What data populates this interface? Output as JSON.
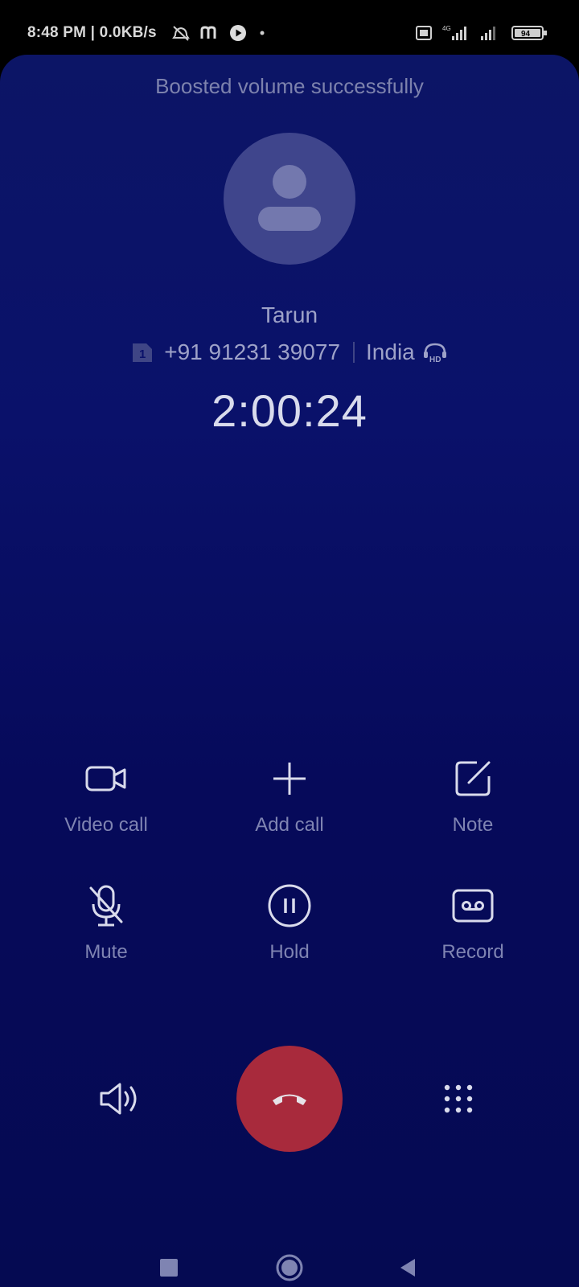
{
  "status_bar": {
    "time_text": "8:48 PM | 0.0KB/s",
    "battery": "94",
    "network": "4G"
  },
  "toast": "Boosted volume successfully",
  "contact": {
    "name": "Tarun",
    "sim_slot": "1",
    "number": "+91 91231 39077",
    "location": "India",
    "hd_badge": "HD"
  },
  "call_timer": "2:00:24",
  "controls": {
    "video_call": {
      "label": "Video call",
      "icon": "video-camera-icon"
    },
    "add_call": {
      "label": "Add call",
      "icon": "plus-icon"
    },
    "note": {
      "label": "Note",
      "icon": "edit-note-icon"
    },
    "mute": {
      "label": "Mute",
      "icon": "mic-off-icon"
    },
    "hold": {
      "label": "Hold",
      "icon": "pause-circle-icon"
    },
    "record": {
      "label": "Record",
      "icon": "cassette-icon"
    }
  },
  "bottom_actions": {
    "speaker": "speaker-icon",
    "end_call": "end-call-icon",
    "dialpad": "dialpad-icon"
  },
  "colors": {
    "background": "#0a116a",
    "end_call": "#a82a3c",
    "label": "#7f84b2",
    "icon": "#d9dbec"
  }
}
